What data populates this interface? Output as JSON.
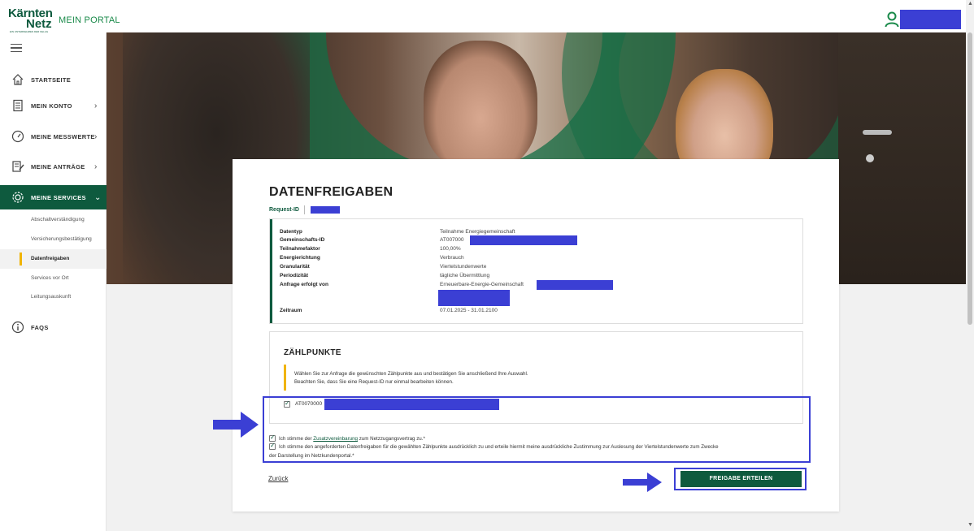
{
  "header": {
    "logo_top": "Kärnten",
    "logo_bottom": "Netz",
    "logo_tagline": "EIN UNTERNEHMEN DER KELAG",
    "portal": "MEIN PORTAL"
  },
  "sidebar": {
    "items": [
      {
        "label": "STARTSEITE",
        "icon": "home-icon",
        "chevron": ""
      },
      {
        "label": "MEIN KONTO",
        "icon": "document-icon",
        "chevron": "›"
      },
      {
        "label": "MEINE MESSWERTE",
        "icon": "gauge-icon",
        "chevron": "›"
      },
      {
        "label": "MEINE ANTRÄGE",
        "icon": "form-icon",
        "chevron": "›"
      },
      {
        "label": "MEINE SERVICES",
        "icon": "gear-icon",
        "chevron": "⌄"
      },
      {
        "label": "FAQS",
        "icon": "info-icon",
        "chevron": ""
      }
    ],
    "sub_items": [
      {
        "label": "Abschaltverständigung"
      },
      {
        "label": "Versicherungsbestätigung"
      },
      {
        "label": "Datenfreigaben"
      },
      {
        "label": "Services vor Ort"
      },
      {
        "label": "Leitungsauskunft"
      }
    ]
  },
  "card": {
    "title": "DATENFREIGABEN",
    "request_id_label": "Request-ID",
    "details": [
      {
        "key": "Datentyp",
        "value": "Teilnahme Energiegemeinschaft"
      },
      {
        "key": "Gemeinschafts-ID",
        "value": "AT007000"
      },
      {
        "key": "Teilnahmefaktor",
        "value": "100,00%"
      },
      {
        "key": "Energierichtung",
        "value": "Verbrauch"
      },
      {
        "key": "Granularität",
        "value": "Viertelstundenwerte"
      },
      {
        "key": "Periodizität",
        "value": "tägliche Übermittlung"
      },
      {
        "key": "Anfrage erfolgt von",
        "value": "Erneuerbare-Energie-Gemeinschaft"
      },
      {
        "key": "Zeitraum",
        "value": "07.01.2025 - 31.01.2100"
      }
    ],
    "zaehlpunkte": {
      "title": "ZÄHLPUNKTE",
      "note_line1": "Wählen Sie zur Anfrage die gewünschten Zählpunkte aus und bestätigen Sie anschließend Ihre Auswahl.",
      "note_line2": "Beachten Sie, dass Sie eine Request-ID nur einmal bearbeiten können.",
      "item": "AT0070000"
    },
    "consent1_pre": "Ich stimme der ",
    "consent1_link": "Zusatzvereinbarung",
    "consent1_post": " zum Netzzugangsvertrag zu.*",
    "consent2_line1": "Ich stimme den angeforderten Datenfreigaben für die gewählten Zählpunkte ausdrücklich zu und erteile hiermit meine ausdrückliche Zustimmung zur Auslesung der Viertelstundenwerte zum Zwecke",
    "consent2_line2": "der Darstellung im Netzkundenportal.*",
    "back": "Zurück",
    "submit": "FREIGABE ERTEILEN"
  },
  "colors": {
    "brand_green": "#0e5a3e",
    "accent_yellow": "#f0b400",
    "annotation_blue": "#3b3fd4"
  }
}
